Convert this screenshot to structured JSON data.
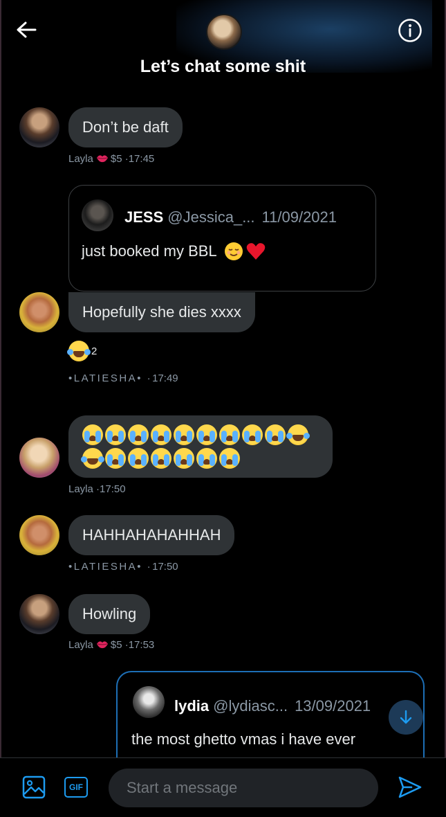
{
  "header": {
    "title": "Let’s chat some shit",
    "back_icon": "arrow-left-icon",
    "info_icon": "info-icon"
  },
  "messages": [
    {
      "text": "Don’t be daft",
      "sender": "Layla",
      "tip": "$5",
      "time": "17:45"
    },
    {
      "quote": {
        "name": "JESS",
        "handle": "@Jessica_...",
        "date": "11/09/2021",
        "text": "just booked my BBL"
      },
      "text": "Hopefully she dies xxxx",
      "reaction_count": "2",
      "sender": "LATIESHA",
      "time": "17:49"
    },
    {
      "emoji_line1_count": 10,
      "emoji_line2_count": 7,
      "sender": "Layla",
      "time": "17:50"
    },
    {
      "text": "HAHHAHAHAHHAH",
      "sender": "LATIESHA",
      "time": "17:50"
    },
    {
      "text": "Howling",
      "sender": "Layla",
      "tip": "$5",
      "time": "17:53"
    },
    {
      "quote": {
        "name": "lydia",
        "handle": "@lydiasc...",
        "date": "13/09/2021",
        "text": "the most ghetto vmas i have ever"
      }
    }
  ],
  "composer": {
    "placeholder": "Start a message",
    "gif_label": "GIF",
    "image_icon": "image-icon",
    "send_icon": "send-icon"
  },
  "colors": {
    "accent": "#1d9bf0",
    "bubble": "#2f3336",
    "background": "#000000"
  }
}
